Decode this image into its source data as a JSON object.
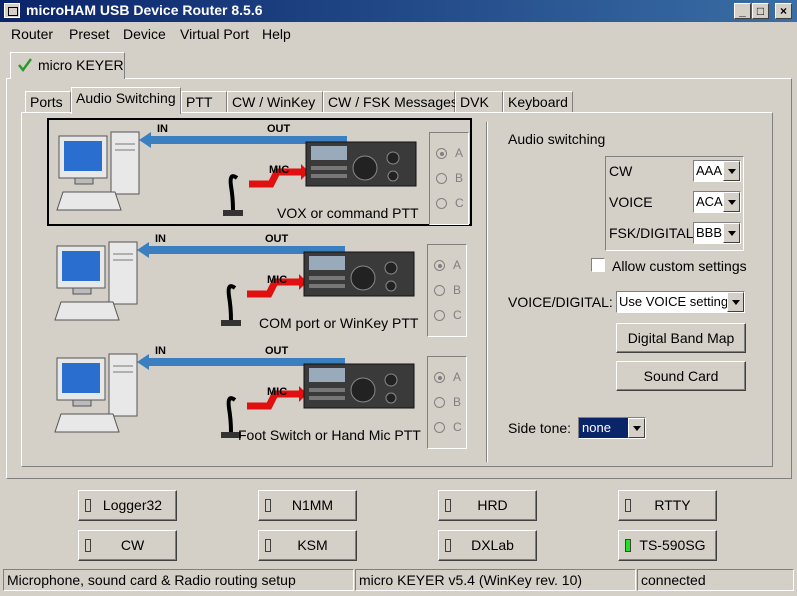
{
  "window": {
    "title": "microHAM USB Device Router 8.5.6"
  },
  "menu": [
    "Router",
    "Preset",
    "Device",
    "Virtual Port",
    "Help"
  ],
  "device_tab": {
    "label": "micro KEYER"
  },
  "tabs": [
    "Ports",
    "Audio Switching",
    "PTT",
    "CW / WinKey",
    "CW / FSK Messages",
    "DVK",
    "Keyboard"
  ],
  "active_tab": "Audio Switching",
  "diagram": {
    "in_label": "IN",
    "out_label": "OUT",
    "mic_label": "MIC"
  },
  "scenarios": [
    {
      "caption": "VOX or command PTT",
      "selected": "A"
    },
    {
      "caption": "COM port or WinKey PTT",
      "selected": "A"
    },
    {
      "caption": "Foot Switch or Hand Mic PTT",
      "selected": "A"
    }
  ],
  "radio_options": [
    "A",
    "B",
    "C"
  ],
  "audio_switching": {
    "title": "Audio switching",
    "rows": [
      {
        "label": "CW",
        "value": "AAA"
      },
      {
        "label": "VOICE",
        "value": "ACA"
      },
      {
        "label": "FSK/DIGITAL",
        "value": "BBB"
      }
    ],
    "allow_custom_label": "Allow custom settings",
    "allow_custom_checked": false,
    "voice_digital_label": "VOICE/DIGITAL:",
    "voice_digital_value": "Use VOICE settings",
    "digital_band_map_label": "Digital Band Map",
    "sound_card_label": "Sound Card",
    "side_tone_label": "Side tone:",
    "side_tone_value": "none"
  },
  "port_buttons": [
    {
      "label": "Logger32",
      "led": "off"
    },
    {
      "label": "N1MM",
      "led": "off"
    },
    {
      "label": "HRD",
      "led": "off"
    },
    {
      "label": "RTTY",
      "led": "off"
    },
    {
      "label": "CW",
      "led": "off"
    },
    {
      "label": "KSM",
      "led": "off"
    },
    {
      "label": "DXLab",
      "led": "off"
    },
    {
      "label": "TS-590SG",
      "led": "on"
    }
  ],
  "status_bar": {
    "description": "Microphone, sound card & Radio routing setup",
    "device": "micro KEYER v5.4 (WinKey rev. 10)",
    "connection": "connected"
  },
  "colors": {
    "title_bar": "#0a246a",
    "audio_line": "#3c7fc1",
    "mic_line": "#e01010",
    "check": "#2a9a2a",
    "led_on": "#22e022"
  }
}
